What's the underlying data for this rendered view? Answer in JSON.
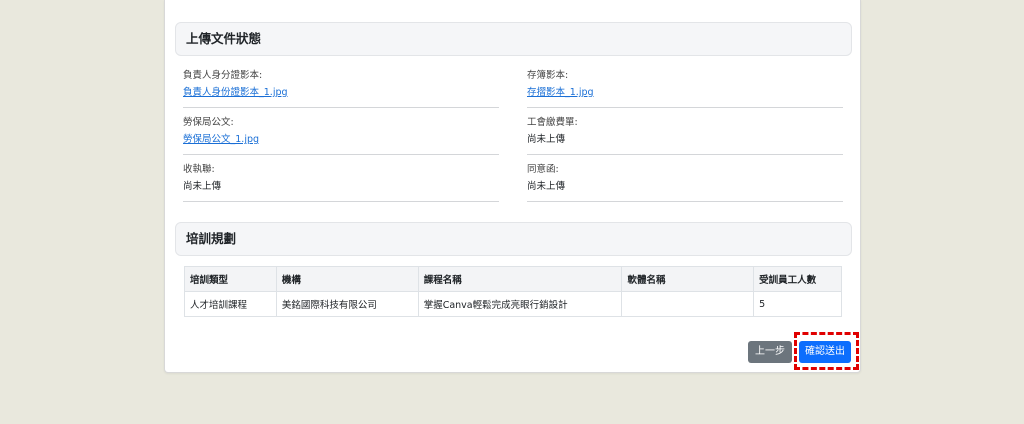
{
  "upload_status": {
    "title": "上傳文件狀態",
    "fields": [
      {
        "label": "負責人身分證影本:",
        "value": "負責人身份證影本_1.jpg",
        "link": true
      },
      {
        "label": "存簿影本:",
        "value": "存摺影本_1.jpg",
        "link": true
      },
      {
        "label": "勞保局公文:",
        "value": "勞保局公文_1.jpg",
        "link": true
      },
      {
        "label": "工會繳費單:",
        "value": "尚未上傳",
        "link": false
      },
      {
        "label": "收執聯:",
        "value": "尚未上傳",
        "link": false
      },
      {
        "label": "同意函:",
        "value": "尚未上傳",
        "link": false
      }
    ]
  },
  "training_plan": {
    "title": "培訓規劃",
    "headers": [
      "培訓類型",
      "機構",
      "課程名稱",
      "軟體名稱",
      "受訓員工人數"
    ],
    "rows": [
      [
        "人才培訓課程",
        "美銘國際科技有限公司",
        "掌握Canva輕鬆完成亮眼行銷設計",
        "",
        "5"
      ]
    ]
  },
  "actions": {
    "prev_label": "上一步",
    "submit_label": "確認送出"
  },
  "colors": {
    "link": "#1a6fd6",
    "primary": "#0d6efd",
    "secondary": "#6c757d",
    "highlight": "#e00000"
  }
}
